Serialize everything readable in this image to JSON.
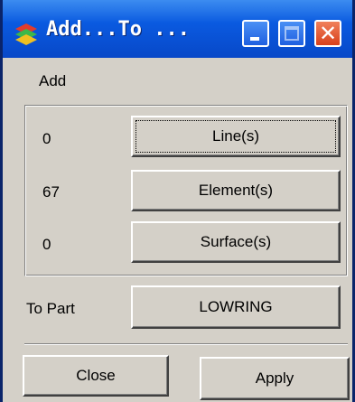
{
  "window": {
    "title": "Add...To ...",
    "icon": "app-icon",
    "controls": [
      "minimize-icon",
      "maximize-icon",
      "close-icon"
    ],
    "colors": {
      "titlebar": "#0a5ae0",
      "close_button": "#d8401c",
      "dialog_bg": "#d4d0c8"
    }
  },
  "add_section": {
    "label": "Add",
    "rows": [
      {
        "count": "0",
        "button_label": "Line(s)"
      },
      {
        "count": "67",
        "button_label": "Element(s)"
      },
      {
        "count": "0",
        "button_label": "Surface(s)"
      }
    ]
  },
  "to_part": {
    "label": "To Part",
    "button_label": "LOWRING"
  },
  "footer": {
    "close_label": "Close",
    "apply_label": "Apply"
  }
}
